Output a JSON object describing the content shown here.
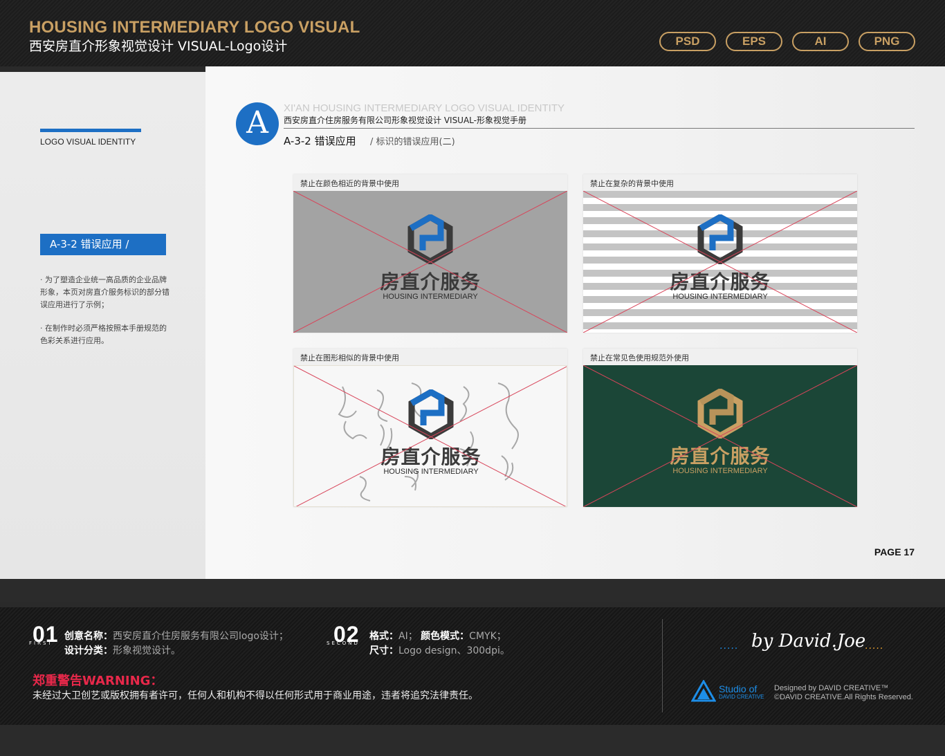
{
  "header": {
    "title_en": "HOUSING INTERMEDIARY LOGO VISUAL",
    "title_cn": "西安房直介形象视觉设计  VISUAL-Logo设计",
    "formats": [
      "PSD",
      "EPS",
      "AI",
      "PNG"
    ],
    "accent_color": "#c9a063"
  },
  "sidebar": {
    "heading": "LOGO VISUAL IDENTITY",
    "section_tag": "A-3-2 错误应用 /",
    "notes": [
      "· 为了塑造企业统一高品质的企业品牌形象，本页对房直介服务标识的部分错误应用进行了示例；",
      "· 在制作时必须严格按照本手册规范的色彩关系进行应用。"
    ]
  },
  "document": {
    "badge_letter": "A",
    "title_en": "XI'AN HOUSING INTERMEDIARY LOGO VISUAL IDENTITY",
    "title_cn": "西安房直介住房服务有限公司形象视觉设计  VISUAL-形象视觉手册",
    "subtitle_strong": "A-3-2 错误应用",
    "subtitle_light": "/ 标识的错误应用(二)",
    "page": "PAGE 17",
    "brand_blue": "#1d6fc4"
  },
  "logo": {
    "name_cn": "房直介服务",
    "name_en": "HOUSING INTERMEDIARY",
    "icon": "hexagon-h-logo-icon"
  },
  "panels": [
    {
      "caption": "禁止在颜色相近的背景中使用",
      "background": "gray"
    },
    {
      "caption": "禁止在复杂的背景中使用",
      "background": "stripes"
    },
    {
      "caption": "禁止在图形相似的背景中使用",
      "background": "calligraphy"
    },
    {
      "caption": "禁止在常见色使用规范外使用",
      "background": "green"
    }
  ],
  "footer": {
    "item1": {
      "num": "01",
      "small": "FIRST",
      "name_label": "创意名称：",
      "name_value": "西安房直介住房服务有限公司logo设计；",
      "cat_label": "设计分类：",
      "cat_value": "形象视觉设计。"
    },
    "item2": {
      "num": "02",
      "small": "SECOND",
      "fmt_label": "格式：",
      "fmt_value": "AI；",
      "color_label": "颜色模式：",
      "color_value": "CMYK；",
      "size_label": "尺寸：",
      "size_value": "Logo design、300dpi。"
    },
    "warning_title": "郑重警告WARNING：",
    "warning_text": "未经过大卫创艺或版权拥有者许可，任何人和机构不得以任何形式用于商业用途，违者将追究法律责任。",
    "signature": "by David.Joe",
    "studio_line1": "Studio of",
    "studio_line2": "DAVID CREATIVE",
    "credit_1": "Designed by DAVID CREATIVE™",
    "credit_2": "©DAVID CREATIVE.All Rights Reserved.",
    "warning_color": "#e8284a"
  }
}
